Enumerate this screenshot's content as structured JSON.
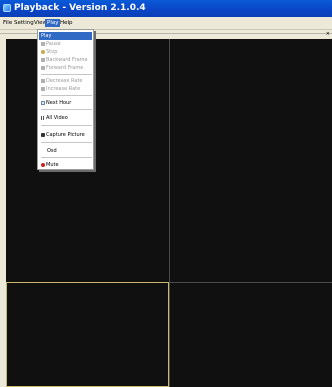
{
  "window": {
    "title": "Playback - Version 2.1.0.4"
  },
  "menubar": {
    "items": [
      "File",
      "Setting",
      "View",
      "Play",
      "Help"
    ],
    "active": "Play"
  },
  "docbar": {
    "close_glyph": "×"
  },
  "play_menu": {
    "items": [
      {
        "label": "Play",
        "state": "highlighted"
      },
      {
        "label": "Pause",
        "state": "disabled",
        "icon": "pause-icon"
      },
      {
        "label": "Stop",
        "state": "disabled",
        "icon": "stop-icon"
      },
      {
        "label": "Backward Frame",
        "state": "disabled",
        "icon": "backward-frame-icon"
      },
      {
        "label": "Forward Frame",
        "state": "disabled",
        "icon": "forward-frame-icon"
      },
      {
        "label": "Decrease Rate",
        "state": "disabled",
        "icon": "decrease-rate-icon"
      },
      {
        "label": "Increase Rate",
        "state": "disabled",
        "icon": "increase-rate-icon"
      },
      {
        "label": "Next Hour",
        "state": "enabled",
        "icon": "next-hour-icon"
      },
      {
        "label": "All Video",
        "state": "enabled",
        "icon": "all-video-icon"
      },
      {
        "label": "Capture Picture",
        "state": "enabled",
        "icon": "camera-icon"
      },
      {
        "label": "Osd",
        "state": "enabled"
      },
      {
        "label": "Mute",
        "state": "enabled",
        "icon": "mute-icon"
      }
    ]
  },
  "colors": {
    "titlebar": "#0b46c8",
    "menu_highlight": "#316ac5",
    "video_bg": "#101010",
    "selected_pane_border": "#c8b870"
  }
}
